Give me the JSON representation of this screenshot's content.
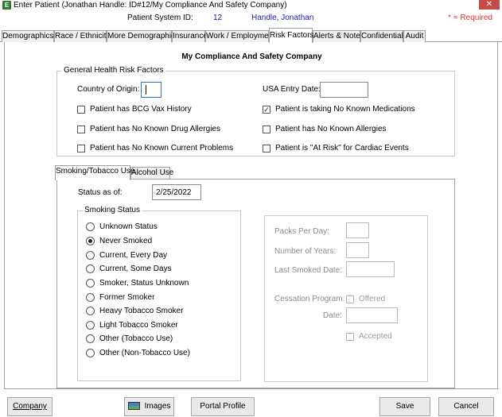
{
  "window": {
    "title": "Enter Patient (Jonathan Handle: ID#12/My Compliance And Safety Company)",
    "close_glyph": "✕",
    "app_icon_glyph": "E"
  },
  "infobar": {
    "system_id_label": "Patient System ID:",
    "system_id_value": "12",
    "patient_name": "Handle, Jonathan",
    "required_note": "* = Required"
  },
  "tabs": [
    {
      "label": "Demographics"
    },
    {
      "label": "Race / Ethnicity"
    },
    {
      "label": "More Demographics"
    },
    {
      "label": "Insurance"
    },
    {
      "label": "Work / Employmen"
    },
    {
      "label": "Risk Factors",
      "active": true
    },
    {
      "label": "Alerts & Notes"
    },
    {
      "label": "Confidential"
    },
    {
      "label": "Audit"
    }
  ],
  "company_heading": "My Compliance And Safety Company",
  "general_health": {
    "legend": "General Health Risk Factors",
    "country_label": "Country of Origin:",
    "country_value": "",
    "usa_entry_label": "USA Entry Date:",
    "usa_entry_value": "",
    "checkboxes": [
      {
        "label": "Patient has BCG Vax History",
        "checked": false
      },
      {
        "label": "Patient is taking No Known Medications",
        "checked": true
      },
      {
        "label": "Patient has No Known Drug Allergies",
        "checked": false
      },
      {
        "label": "Patient has No Known Allergies",
        "checked": false
      },
      {
        "label": "Patient has No Known Current Problems",
        "checked": false
      },
      {
        "label": "Patient is \"At Risk\" for Cardiac Events",
        "checked": false
      }
    ],
    "check_glyph": "✓"
  },
  "subtabs": [
    {
      "label": "Smoking/Tobacco Use",
      "active": true
    },
    {
      "label": "Alcohol Use",
      "active": false
    }
  ],
  "smoking": {
    "status_as_of_label": "Status as of:",
    "status_as_of_value": "2/25/2022",
    "status_legend": "Smoking Status",
    "options": [
      {
        "label": "Unknown Status",
        "selected": false
      },
      {
        "label": "Never Smoked",
        "selected": true
      },
      {
        "label": "Current, Every Day",
        "selected": false
      },
      {
        "label": "Current, Some Days",
        "selected": false
      },
      {
        "label": "Smoker, Status Unknown",
        "selected": false
      },
      {
        "label": "Former Smoker",
        "selected": false
      },
      {
        "label": "Heavy Tobacco Smoker",
        "selected": false
      },
      {
        "label": "Light Tobacco Smoker",
        "selected": false
      },
      {
        "label": "Other (Tobacco Use)",
        "selected": false
      },
      {
        "label": "Other (Non-Tobacco Use)",
        "selected": false
      }
    ],
    "details": {
      "packs_per_day_label": "Packs Per Day:",
      "number_of_years_label": "Number of Years:",
      "last_smoked_label": "Last Smoked Date:",
      "cessation_label": "Cessation Program:",
      "offered_label": "Offered",
      "date_label": "Date:",
      "accepted_label": "Accepted"
    }
  },
  "buttons": {
    "company": "Company",
    "images": "Images",
    "portal_profile": "Portal Profile",
    "save": "Save",
    "cancel": "Cancel"
  },
  "colors": {
    "link_blue": "#1a1a9c",
    "required_red": "#e03030",
    "focus_blue": "#2a6fd6",
    "close_red": "#c64a4a"
  }
}
